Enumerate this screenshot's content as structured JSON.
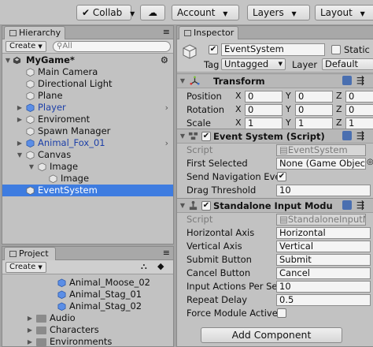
{
  "toolbar": {
    "collab": "Collab",
    "account": "Account",
    "layers": "Layers",
    "layout": "Layout"
  },
  "hierarchy": {
    "tab": "Hierarchy",
    "create": "Create",
    "search_placeholder": "All",
    "scene": "MyGame*",
    "items": [
      {
        "label": "Main Camera"
      },
      {
        "label": "Directional Light"
      },
      {
        "label": "Plane"
      },
      {
        "label": "Player"
      },
      {
        "label": "Enviroment"
      },
      {
        "label": "Spawn Manager"
      },
      {
        "label": "Animal_Fox_01"
      },
      {
        "label": "Canvas"
      },
      {
        "label": "Image"
      },
      {
        "label": "Image"
      },
      {
        "label": "EventSystem"
      }
    ]
  },
  "project": {
    "tab": "Project",
    "create": "Create",
    "items": [
      {
        "label": "Animal_Moose_02"
      },
      {
        "label": "Animal_Stag_01"
      },
      {
        "label": "Animal_Stag_02"
      },
      {
        "label": "Audio"
      },
      {
        "label": "Characters"
      },
      {
        "label": "Environments"
      }
    ]
  },
  "inspector": {
    "tab": "Inspector",
    "object_name": "EventSystem",
    "static_label": "Static",
    "tag_label": "Tag",
    "tag_value": "Untagged",
    "layer_label": "Layer",
    "layer_value": "Default",
    "transform": {
      "title": "Transform",
      "position_label": "Position",
      "rotation_label": "Rotation",
      "scale_label": "Scale",
      "x": "X",
      "y": "Y",
      "z": "Z",
      "position": [
        "0",
        "0",
        "0"
      ],
      "rotation": [
        "0",
        "0",
        "0"
      ],
      "scale": [
        "1",
        "1",
        "1"
      ]
    },
    "event_system": {
      "title": "Event System (Script)",
      "script_label": "Script",
      "script_value": "EventSystem",
      "first_selected_label": "First Selected",
      "first_selected_value": "None (Game Object",
      "send_nav_label": "Send Navigation Eve",
      "drag_label": "Drag Threshold",
      "drag_value": "10"
    },
    "standalone": {
      "title": "Standalone Input Modu",
      "script_label": "Script",
      "script_value": "StandaloneInputM",
      "h_axis_label": "Horizontal Axis",
      "h_axis_value": "Horizontal",
      "v_axis_label": "Vertical Axis",
      "v_axis_value": "Vertical",
      "submit_label": "Submit Button",
      "submit_value": "Submit",
      "cancel_label": "Cancel Button",
      "cancel_value": "Cancel",
      "actions_label": "Input Actions Per Se",
      "actions_value": "10",
      "repeat_label": "Repeat Delay",
      "repeat_value": "0.5",
      "force_label": "Force Module Active"
    },
    "add_component": "Add Component"
  },
  "colors": {
    "selection": "#3e7ce0",
    "prefab_text": "#1c3fa8",
    "panel_bg": "#c2c2c2"
  }
}
